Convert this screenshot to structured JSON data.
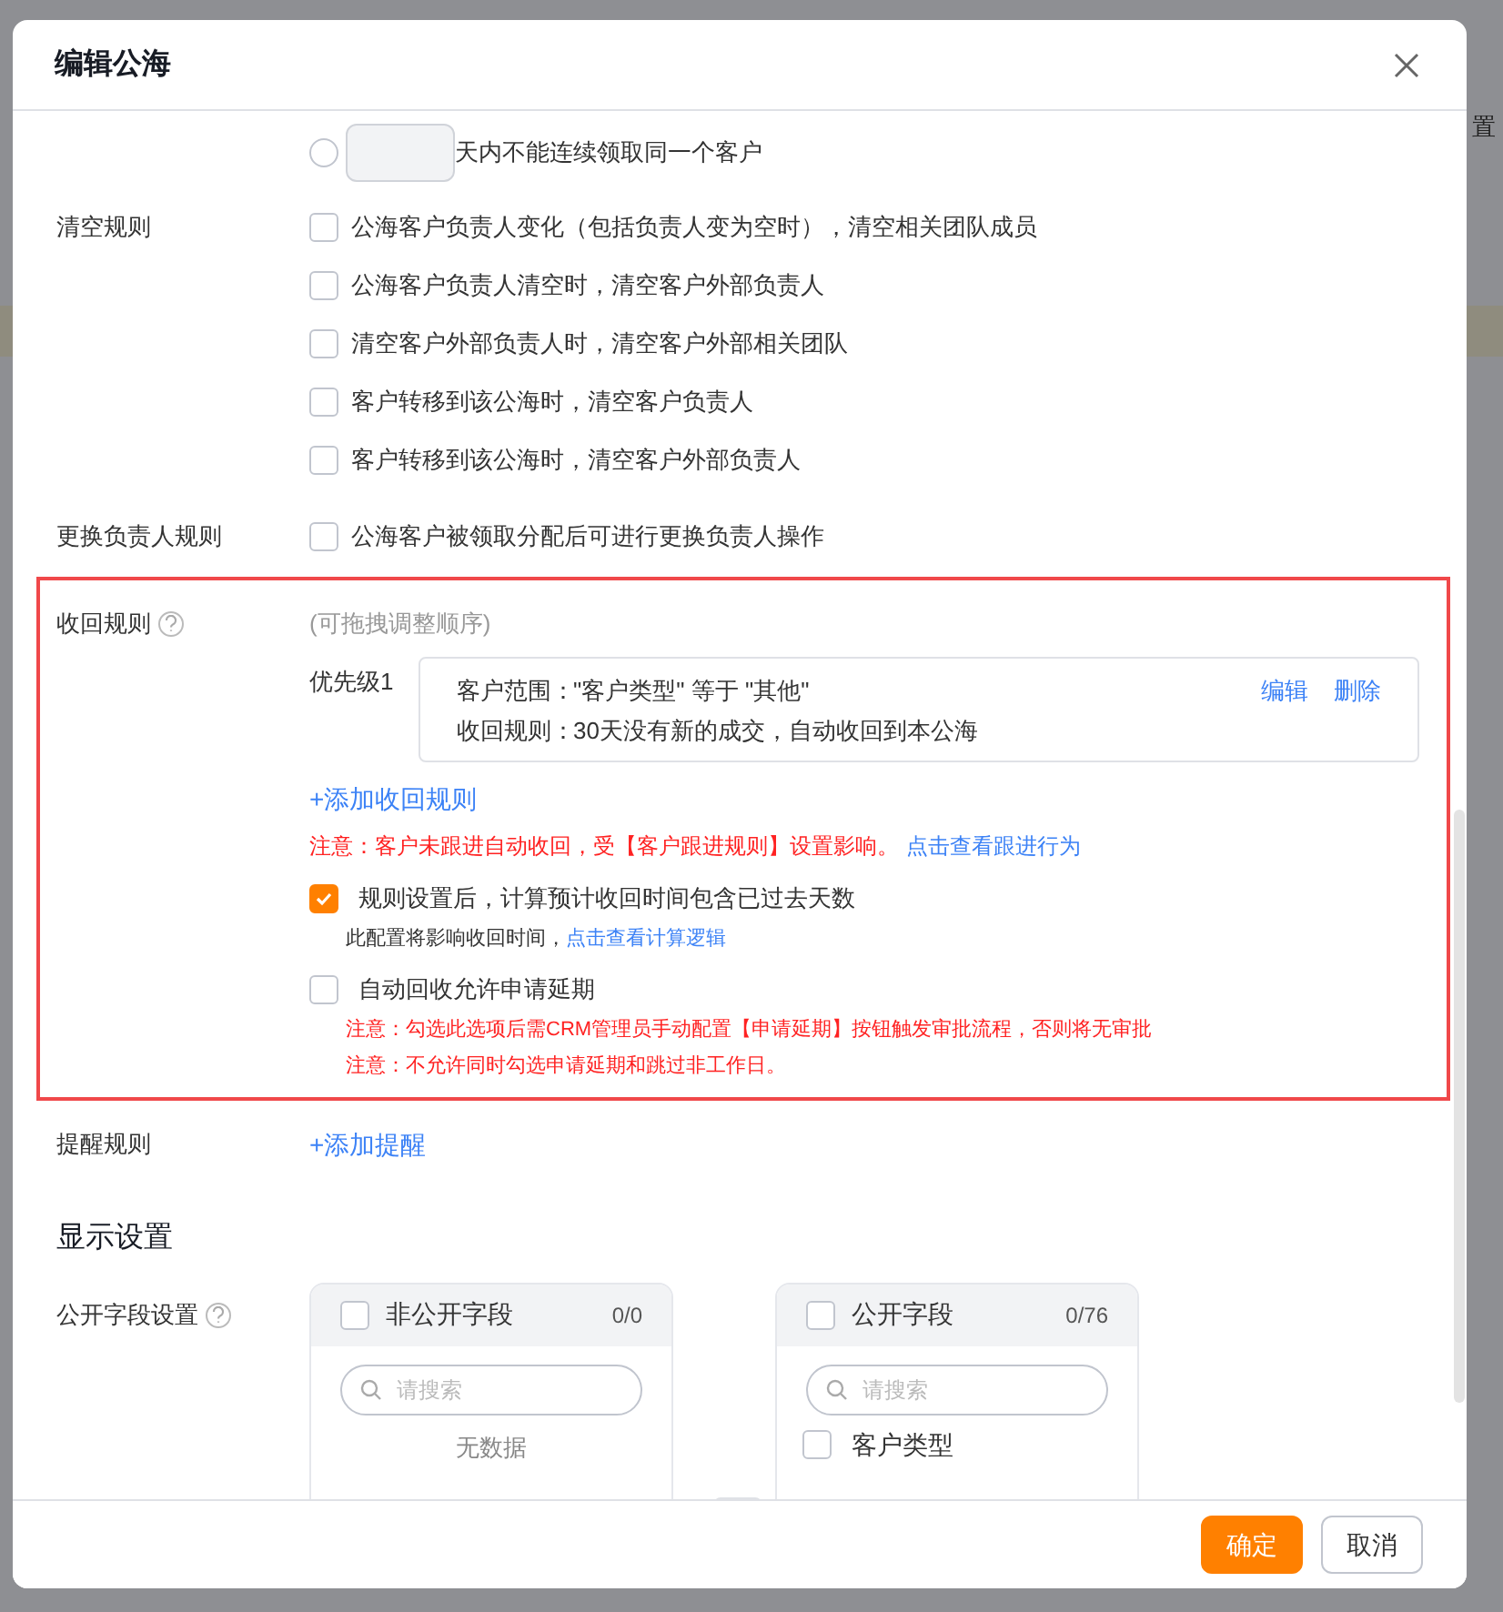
{
  "background_text": "置",
  "dialog": {
    "title": "编辑公海"
  },
  "claim_limit": {
    "selected": false,
    "suffix": "天内不能连续领取同一个客户"
  },
  "clear_rules": {
    "label": "清空规则",
    "options": [
      {
        "text": "公海客户负责人变化（包括负责人变为空时），清空相关团队成员",
        "checked": false
      },
      {
        "text": "公海客户负责人清空时，清空客户外部负责人",
        "checked": false
      },
      {
        "text": "清空客户外部负责人时，清空客户外部相关团队",
        "checked": false
      },
      {
        "text": "客户转移到该公海时，清空客户负责人",
        "checked": false
      },
      {
        "text": "客户转移到该公海时，清空客户外部负责人",
        "checked": false
      }
    ]
  },
  "change_owner_rules": {
    "label": "更换负责人规则",
    "options": [
      {
        "text": "公海客户被领取分配后可进行更换负责人操作",
        "checked": false
      }
    ]
  },
  "recall_rules": {
    "label": "收回规则",
    "hint": "(可拖拽调整顺序)",
    "rules": [
      {
        "priority": "优先级1",
        "lines": [
          {
            "key": "客户范围：",
            "value": "\"客户类型\" 等于 \"其他\""
          },
          {
            "key": "收回规则：",
            "value": "30天没有新的成交，自动收回到本公海"
          }
        ],
        "actions": [
          "编辑",
          "删除"
        ]
      }
    ],
    "add_link": "+添加收回规则",
    "notice": "注意：客户未跟进自动收回，受【客户跟进规则】设置影响。",
    "notice_link": "点击查看跟进行为",
    "options": [
      {
        "text": "规则设置后，计算预计收回时间包含已过去天数",
        "checked": true,
        "notes": [
          {
            "kind": "info",
            "text": "此配置将影响收回时间，",
            "link": "点击查看计算逻辑"
          }
        ]
      },
      {
        "text": "自动回收允许申请延期",
        "checked": false,
        "notes": [
          {
            "kind": "warning",
            "text": "注意：勾选此选项后需CRM管理员手动配置【申请延期】按钮触发审批流程，否则将无审批"
          },
          {
            "kind": "warning",
            "text": "注意：不允许同时勾选申请延期和跳过非工作日。"
          }
        ]
      }
    ]
  },
  "reminder_rules": {
    "label": "提醒规则",
    "add_link": "+添加提醒"
  },
  "display_settings": {
    "title": "显示设置",
    "field_label": "公开字段设置",
    "panels": [
      {
        "title": "非公开字段",
        "count": "0/0",
        "checked": false,
        "search_placeholder": "请搜索",
        "empty_text": "无数据"
      },
      {
        "title": "公开字段",
        "count": "0/76",
        "checked": false,
        "search_placeholder": "请搜索",
        "items": [
          {
            "text": "客户类型",
            "checked": false
          }
        ]
      }
    ]
  },
  "footer": {
    "buttons": [
      {
        "label": "确定",
        "kind": "primary"
      },
      {
        "label": "取消",
        "kind": "default"
      }
    ]
  }
}
